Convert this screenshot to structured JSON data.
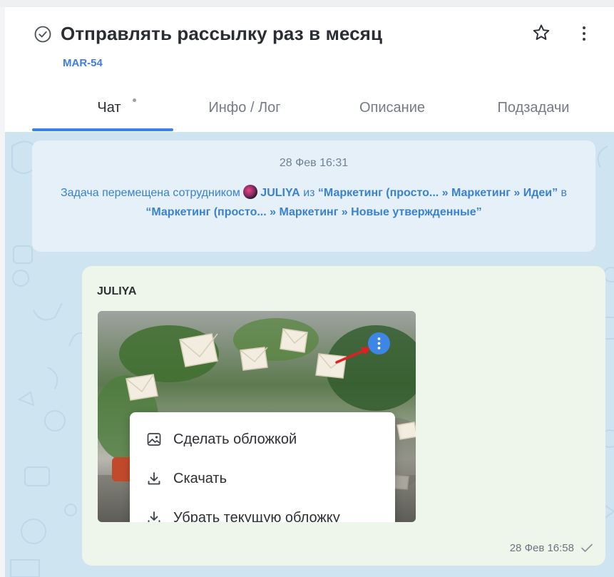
{
  "task": {
    "title": "Отправлять рассылку раз в месяц",
    "key": "MAR-54",
    "status_icon": "check-circle-icon",
    "favorite_icon": "star-icon",
    "more_icon": "more-vertical-icon"
  },
  "tabs": [
    {
      "label": "Чат",
      "active": true,
      "has_dot": true
    },
    {
      "label": "Инфо / Лог",
      "active": false
    },
    {
      "label": "Описание",
      "active": false
    },
    {
      "label": "Подзадачи",
      "active": false
    }
  ],
  "system_message": {
    "date": "28 Фев 16:31",
    "prefix": "Задача перемещена сотрудником",
    "user": "JULIYA",
    "text_middle": "из",
    "from": "“Маркетинг (просто... » Маркетинг » Идеи”",
    "text_in": "в",
    "to": "“Маркетинг (просто... » Маркетинг » Новые утвержденные”"
  },
  "message": {
    "author": "JULIYA",
    "time": "28 Фев 16:58",
    "status_icon": "check-icon",
    "attachment": {
      "type": "image",
      "menu_icon": "more-vertical-icon"
    }
  },
  "context_menu": {
    "items": [
      {
        "label": "Сделать обложкой",
        "icon": "image-icon"
      },
      {
        "label": "Скачать",
        "icon": "download-icon"
      },
      {
        "label": "Убрать текущую обложку",
        "icon": "download-icon"
      }
    ]
  },
  "colors": {
    "accent": "#3b82e8",
    "link": "#3a82cf",
    "chat_background": "#cfe4f1",
    "message_background": "#eef5ea",
    "annotation_arrow": "#e02020"
  }
}
